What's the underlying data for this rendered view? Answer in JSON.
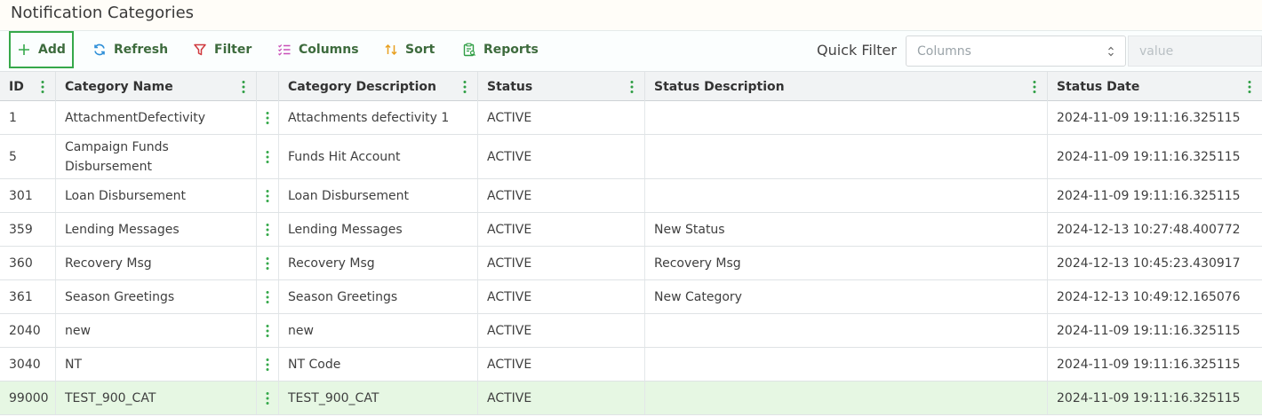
{
  "page": {
    "title": "Notification Categories"
  },
  "toolbar": {
    "add_label": "Add",
    "refresh_label": "Refresh",
    "filter_label": "Filter",
    "columns_label": "Columns",
    "sort_label": "Sort",
    "reports_label": "Reports",
    "quick_filter_label": "Quick Filter",
    "quick_filter_columns_placeholder": "Columns",
    "quick_filter_value_placeholder": "value"
  },
  "colors": {
    "accent_green": "#35a84a",
    "toolbar_text": "#3d6b3d",
    "refresh_icon": "#2f8fd8",
    "filter_icon": "#d0393e",
    "columns_icon": "#c94fb8",
    "sort_icon": "#e8a020",
    "reports_icon": "#2f9e45",
    "selected_row": "#e6f7e3"
  },
  "icons": {
    "add": "plus-icon",
    "refresh": "refresh-icon",
    "filter": "funnel-icon",
    "columns": "columns-list-icon",
    "sort": "sort-arrows-icon",
    "reports": "report-clipboard-icon",
    "column_menu": "kebab-menu-icon",
    "select_chevron": "updown-chevron-icon"
  },
  "grid": {
    "columns": [
      {
        "key": "id",
        "label": "ID"
      },
      {
        "key": "category_name",
        "label": "Category Name"
      },
      {
        "key": "row_menu",
        "label": ""
      },
      {
        "key": "category_description",
        "label": "Category Description"
      },
      {
        "key": "status",
        "label": "Status"
      },
      {
        "key": "status_description",
        "label": "Status Description"
      },
      {
        "key": "status_date",
        "label": "Status Date"
      }
    ],
    "rows": [
      {
        "id": "1",
        "category_name": "AttachmentDefectivity",
        "category_description": "Attachments defectivity 1",
        "status": "ACTIVE",
        "status_description": "",
        "status_date": "2024-11-09 19:11:16.325115"
      },
      {
        "id": "5",
        "category_name": "Campaign Funds Disbursement",
        "category_description": "Funds Hit Account",
        "status": "ACTIVE",
        "status_description": "",
        "status_date": "2024-11-09 19:11:16.325115"
      },
      {
        "id": "301",
        "category_name": "Loan Disbursement",
        "category_description": "Loan Disbursement",
        "status": "ACTIVE",
        "status_description": "",
        "status_date": "2024-11-09 19:11:16.325115"
      },
      {
        "id": "359",
        "category_name": "Lending Messages",
        "category_description": "Lending Messages",
        "status": "ACTIVE",
        "status_description": "New Status",
        "status_date": "2024-12-13 10:27:48.400772"
      },
      {
        "id": "360",
        "category_name": "Recovery Msg",
        "category_description": "Recovery Msg",
        "status": "ACTIVE",
        "status_description": "Recovery Msg",
        "status_date": "2024-12-13 10:45:23.430917"
      },
      {
        "id": "361",
        "category_name": "Season Greetings",
        "category_description": "Season Greetings",
        "status": "ACTIVE",
        "status_description": "New Category",
        "status_date": "2024-12-13 10:49:12.165076"
      },
      {
        "id": "2040",
        "category_name": "new",
        "category_description": "new",
        "status": "ACTIVE",
        "status_description": "",
        "status_date": "2024-11-09 19:11:16.325115"
      },
      {
        "id": "3040",
        "category_name": "NT",
        "category_description": "NT Code",
        "status": "ACTIVE",
        "status_description": "",
        "status_date": "2024-11-09 19:11:16.325115"
      },
      {
        "id": "99000",
        "category_name": "TEST_900_CAT",
        "category_description": "TEST_900_CAT",
        "status": "ACTIVE",
        "status_description": "",
        "status_date": "2024-11-09 19:11:16.325115"
      }
    ]
  }
}
